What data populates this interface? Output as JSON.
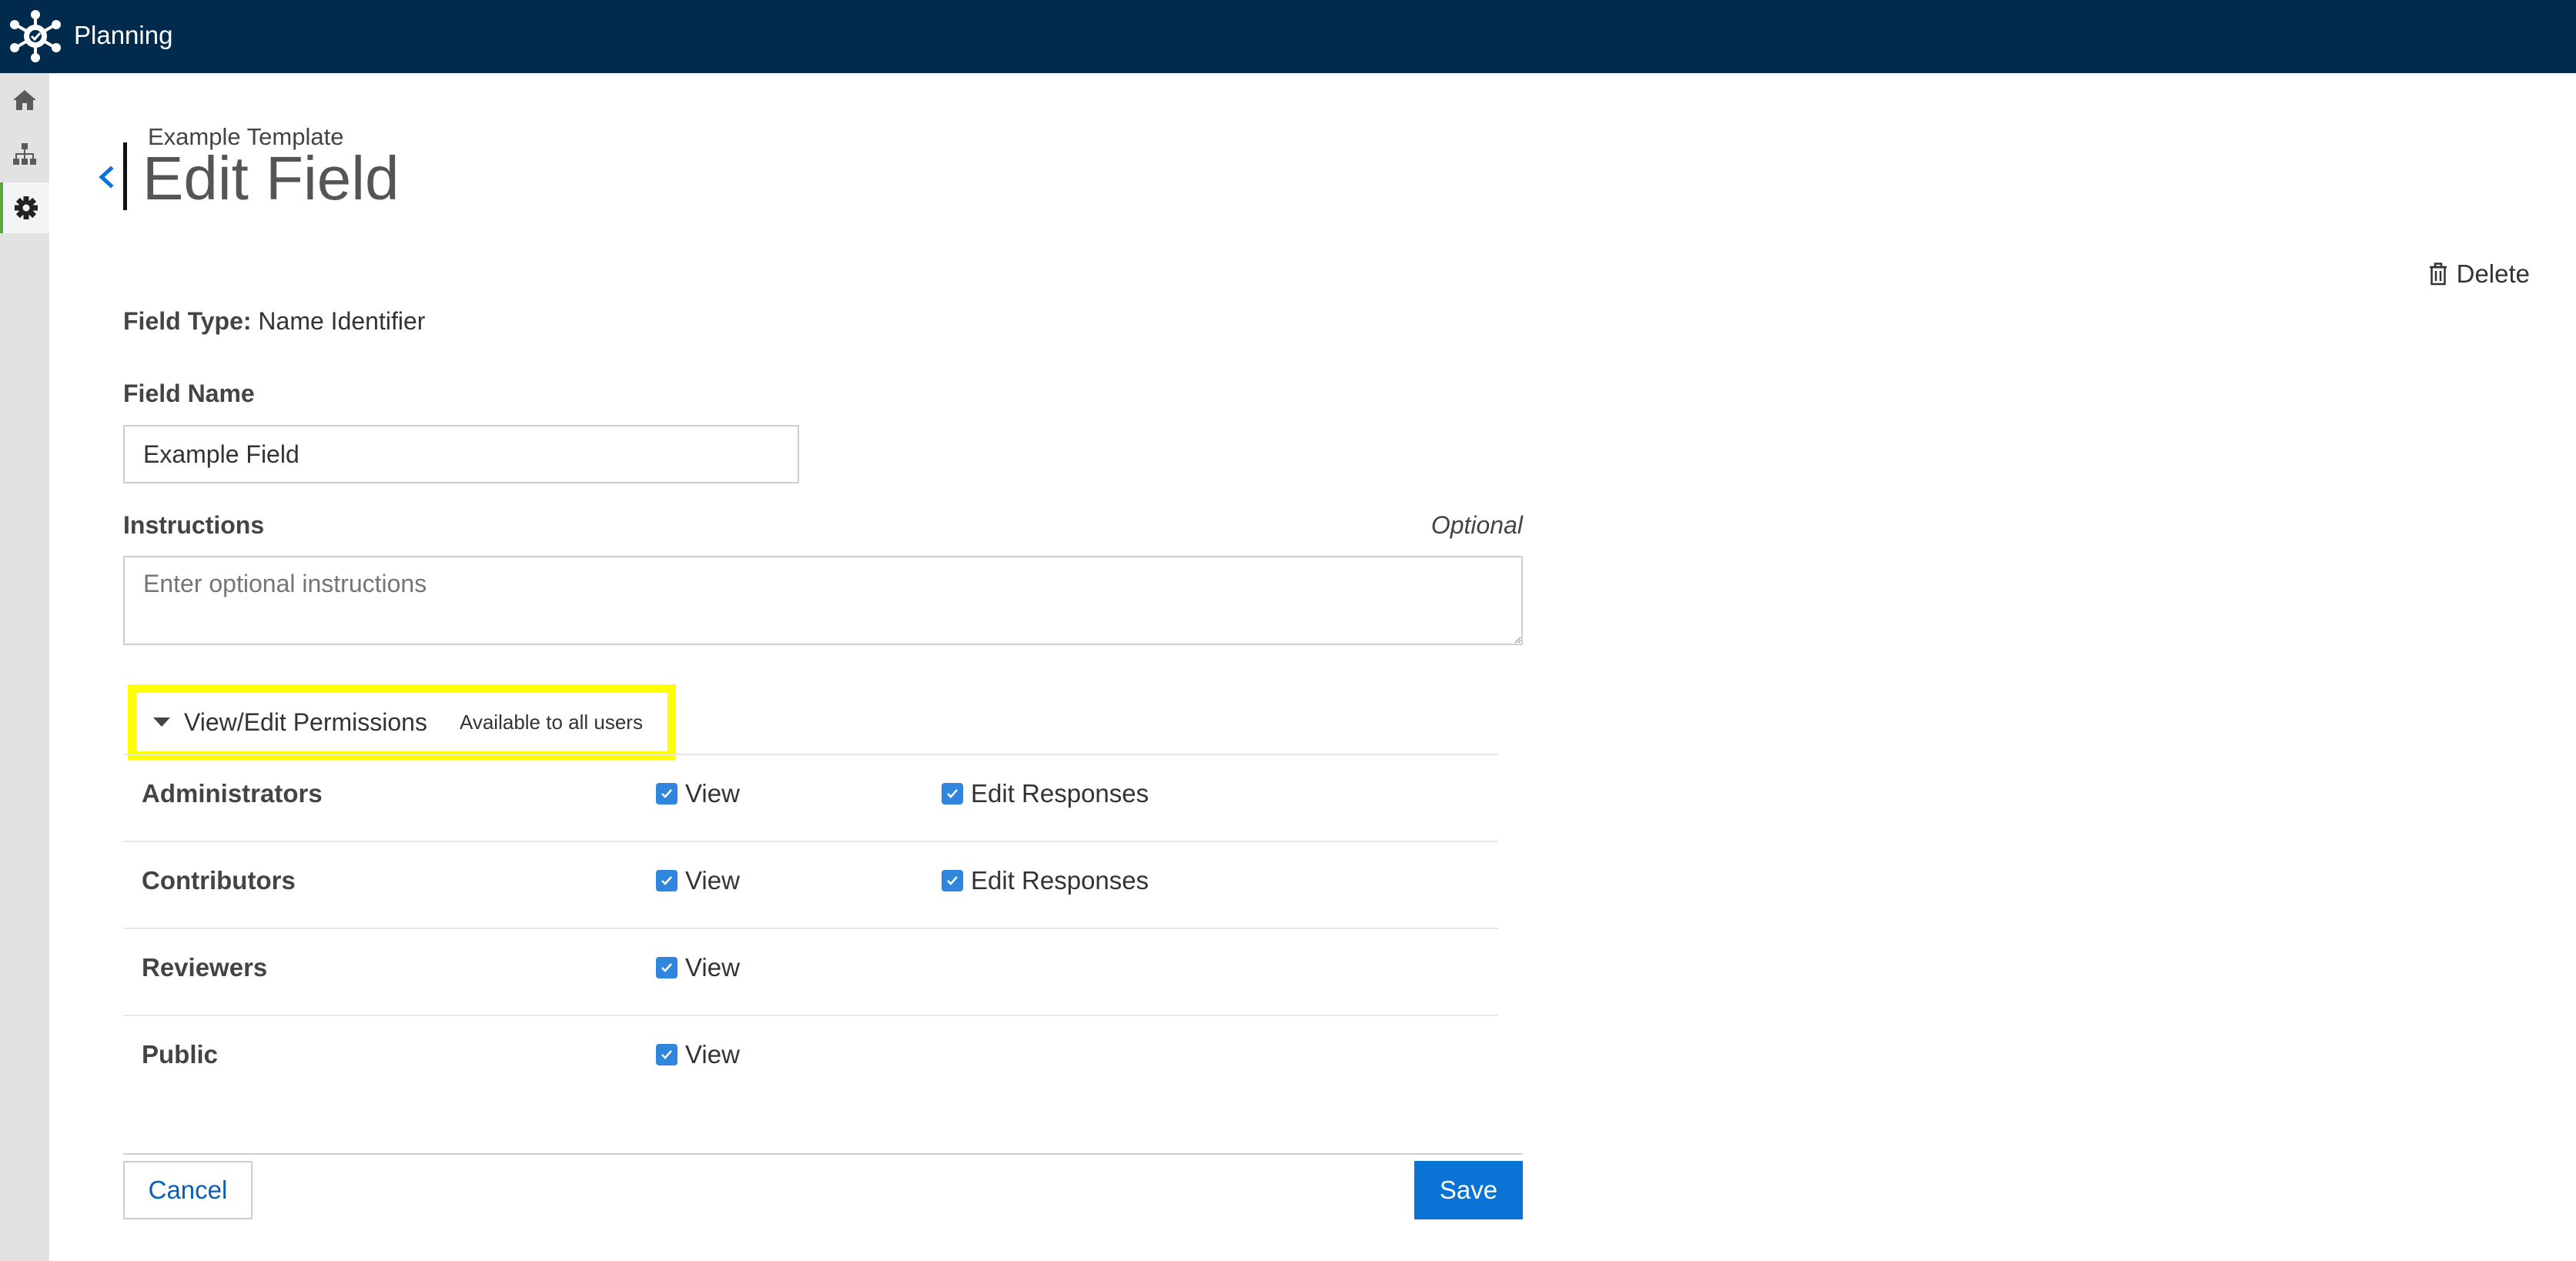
{
  "app": {
    "title": "Planning",
    "logo_icon": "network-gear-logo-icon",
    "colors": {
      "topbar": "#012b4d",
      "sidebar": "#e2e2e2",
      "accent": "#0a74d6",
      "checkbox": "#2f86dc",
      "highlight": "#ffff00"
    }
  },
  "sidebar": {
    "items": [
      {
        "icon": "home-icon",
        "active": false
      },
      {
        "icon": "sitemap-icon",
        "active": false
      },
      {
        "icon": "gear-icon",
        "active": true
      }
    ]
  },
  "header": {
    "breadcrumb": "Example Template",
    "title": "Edit Field",
    "delete_label": "Delete"
  },
  "form": {
    "field_type_label": "Field Type",
    "field_type_value": "Name Identifier",
    "field_name_label": "Field Name",
    "field_name_value": "Example Field",
    "instructions_label": "Instructions",
    "instructions_optional": "Optional",
    "instructions_placeholder": "Enter optional instructions"
  },
  "permissions": {
    "title": "View/Edit Permissions",
    "summary": "Available to all users",
    "rows": [
      {
        "role": "Administrators",
        "view_label": "View",
        "view_checked": true,
        "edit_label": "Edit Responses",
        "edit_checked": true
      },
      {
        "role": "Contributors",
        "view_label": "View",
        "view_checked": true,
        "edit_label": "Edit Responses",
        "edit_checked": true
      },
      {
        "role": "Reviewers",
        "view_label": "View",
        "view_checked": true
      },
      {
        "role": "Public",
        "view_label": "View",
        "view_checked": true
      }
    ]
  },
  "actions": {
    "cancel_label": "Cancel",
    "save_label": "Save"
  }
}
